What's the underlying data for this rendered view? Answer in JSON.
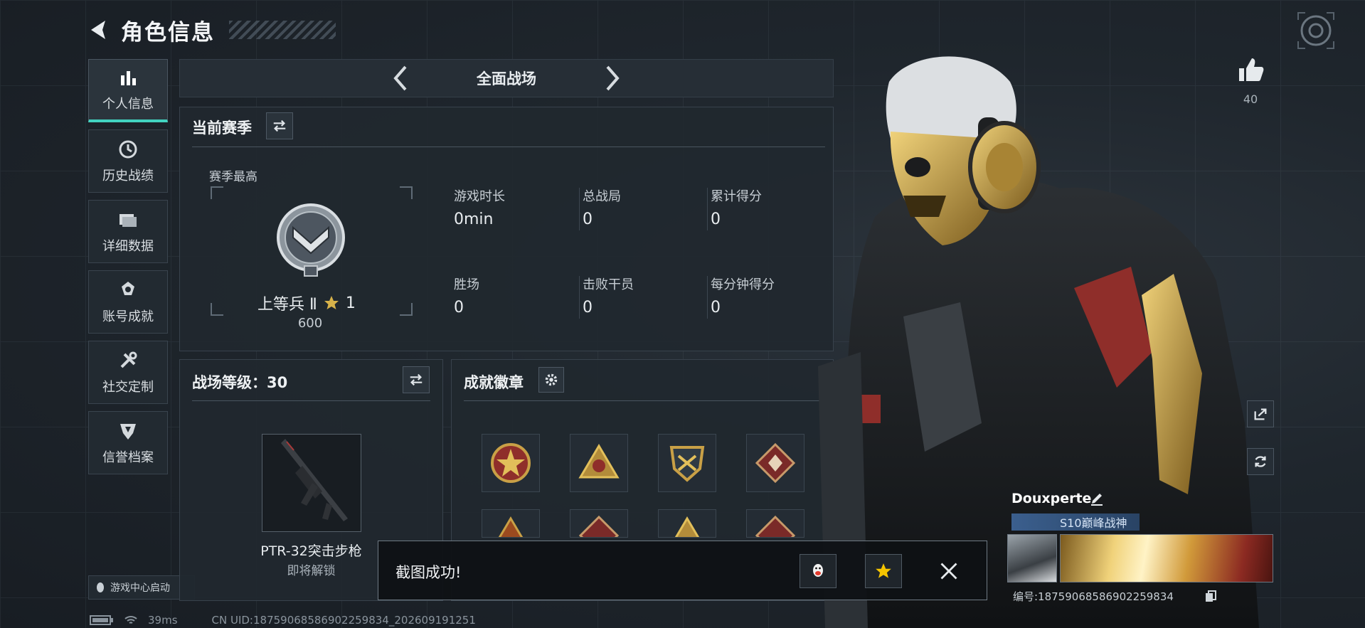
{
  "header": {
    "title": "角色信息",
    "back_icon": "back-arrow-icon"
  },
  "sidebar": {
    "items": [
      {
        "label": "个人信息",
        "icon": "bar-chart-icon",
        "active": true
      },
      {
        "label": "历史战绩",
        "icon": "clock-history-icon",
        "active": false
      },
      {
        "label": "详细数据",
        "icon": "folder-icon",
        "active": false
      },
      {
        "label": "账号成就",
        "icon": "medal-icon",
        "active": false
      },
      {
        "label": "社交定制",
        "icon": "tools-icon",
        "active": false
      },
      {
        "label": "信誉档案",
        "icon": "shield-credit-icon",
        "active": false
      }
    ],
    "launch_label": "游戏中心启动"
  },
  "mode_selector": {
    "current": "全面战场"
  },
  "season": {
    "title": "当前赛季",
    "highest_label": "赛季最高",
    "rank_name": "上等兵 Ⅱ",
    "rank_stars": "1",
    "rank_points": "600",
    "stats": [
      {
        "label": "游戏时长",
        "value": "0min"
      },
      {
        "label": "总战局",
        "value": "0"
      },
      {
        "label": "累计得分",
        "value": "0"
      },
      {
        "label": "胜场",
        "value": "0"
      },
      {
        "label": "击败干员",
        "value": "0"
      },
      {
        "label": "每分钟得分",
        "value": "0"
      }
    ]
  },
  "battlefield_level": {
    "title": "战场等级：30",
    "weapon_name": "PTR-32突击步枪",
    "weapon_status": "即将解锁"
  },
  "achievements": {
    "title": "成就徽章"
  },
  "player": {
    "likes": "40",
    "name": "Douxperte",
    "title_tag": "S10巅峰战神",
    "id_text": "编号:18759068586902259834"
  },
  "toast": {
    "message": "截图成功!"
  },
  "status_bar": {
    "ping": "39ms",
    "uid": "CN UID:18759068586902259834_202609191251"
  },
  "colors": {
    "accent": "#42d3c0",
    "panel": "#21282f",
    "gold": "#c9a046"
  }
}
